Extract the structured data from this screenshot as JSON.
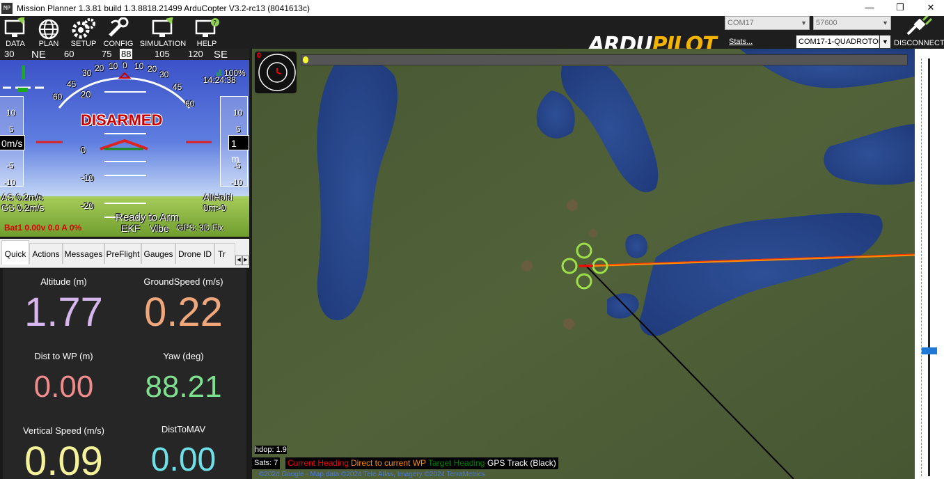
{
  "window": {
    "app_icon": "MP",
    "title": "Mission Planner 1.3.81 build 1.3.8818.21499 ArduCopter V3.2-rc13 (8041613c)",
    "minimize": "—",
    "restore": "❐",
    "close": "✕"
  },
  "toolbar": {
    "items": [
      {
        "label": "DATA",
        "icon": "data-monitor-icon"
      },
      {
        "label": "PLAN",
        "icon": "globe-plan-icon"
      },
      {
        "label": "SETUP",
        "icon": "gears-setup-icon"
      },
      {
        "label": "CONFIG",
        "icon": "wrench-config-icon"
      },
      {
        "label": "SIMULATION",
        "icon": "monitor-simulation-icon"
      },
      {
        "label": "HELP",
        "icon": "monitor-help-icon"
      }
    ],
    "logo_left": "ARDU",
    "logo_right": "PILOT",
    "com_port": "COM17",
    "baud": "57600",
    "stats_link": "Stats...",
    "connection": "COM17-1-QUADROTOR",
    "disconnect_label": "DISCONNECT"
  },
  "hud": {
    "compass": [
      "30",
      "NE",
      "60",
      "75",
      "88",
      "105",
      "120",
      "SE"
    ],
    "status": "DISARMED",
    "airspeed_tape": "0m/s",
    "alt_tape": "1 m",
    "battery_percent_label": "100%",
    "time": "14:24:38",
    "as": "AS 0.2m/s",
    "gs": "GS 0.2m/s",
    "mode": "AltHold",
    "dist": "0m>0",
    "ready": "Ready to Arm",
    "ekf": "EKF",
    "vibe": "Vibe",
    "gps": "GPS: 3D Fix",
    "battery": "Bat1 0.00v 0.0 A 0%",
    "pitch_labels": [
      "20",
      "10",
      "0",
      "-10",
      "-20"
    ],
    "roll_labels": [
      "60",
      "45",
      "30",
      "20",
      "10",
      "0",
      "10",
      "20",
      "30",
      "45",
      "60"
    ],
    "tape_labels": [
      "10",
      "5",
      "-5",
      "-10"
    ],
    "roll_value": "0",
    "colors": {
      "sky": "#3b52c8",
      "ground": "#7bbf3f",
      "warning": "#cc0000"
    }
  },
  "tabs": {
    "items": [
      "Quick",
      "Actions",
      "Messages",
      "PreFlight",
      "Gauges",
      "Drone ID",
      "Tr"
    ],
    "active": "Quick"
  },
  "quick": [
    {
      "label": "Altitude (m)",
      "value": "1.77",
      "color": "#d7b6ee"
    },
    {
      "label": "GroundSpeed (m/s)",
      "value": "0.22",
      "color": "#f0a77c"
    },
    {
      "label": "Dist to WP (m)",
      "value": "0.00",
      "color": "#f08c8c"
    },
    {
      "label": "Yaw (deg)",
      "value": "88.21",
      "color": "#7ee08e"
    },
    {
      "label": "Vertical Speed (m/s)",
      "value": "0.09",
      "color": "#f4f29a"
    },
    {
      "label": "DistToMAV",
      "value": "0.00",
      "color": "#6fe0e8"
    }
  ],
  "map": {
    "mini_label": "0",
    "hdop": "hdop: 1.9",
    "sats": "Sats: 7",
    "legend": [
      {
        "label": "Current Heading",
        "color": "#ff0000"
      },
      {
        "label": "Direct to current WP",
        "color": "#ff8c00"
      },
      {
        "label": "Target Heading",
        "color": "#008000"
      },
      {
        "label": "GPS Track (Black)",
        "color": "#ffffff"
      }
    ],
    "copyright": "©2024 Google - Map data ©2024 Tele Atlas, Imagery ©2024 TerraMetrics"
  }
}
